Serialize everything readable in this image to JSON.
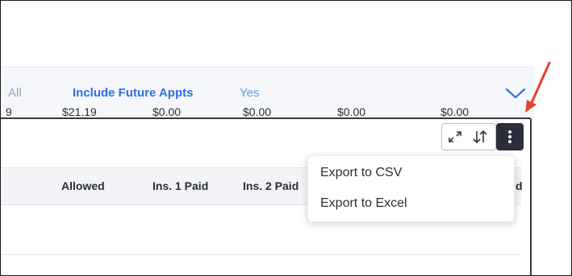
{
  "filter": {
    "all_text": "All",
    "label": "Include Future Appts",
    "value": "Yes",
    "chevron_icon": "chevron-down-icon"
  },
  "toolbar": {
    "icons": [
      "expand-icon",
      "sort-icon",
      "more-vertical-icon"
    ]
  },
  "table": {
    "columns": [
      "Allowed",
      "Ins. 1 Paid",
      "Ins. 2 Paid",
      "d"
    ],
    "row": [
      "9",
      "$21.19",
      "$0.00",
      "$0.00",
      "$0.00",
      "$0.00"
    ]
  },
  "menu": {
    "items": [
      "Export to CSV",
      "Export to Excel"
    ]
  },
  "annotation": {
    "arrow_color": "#e8402a"
  }
}
